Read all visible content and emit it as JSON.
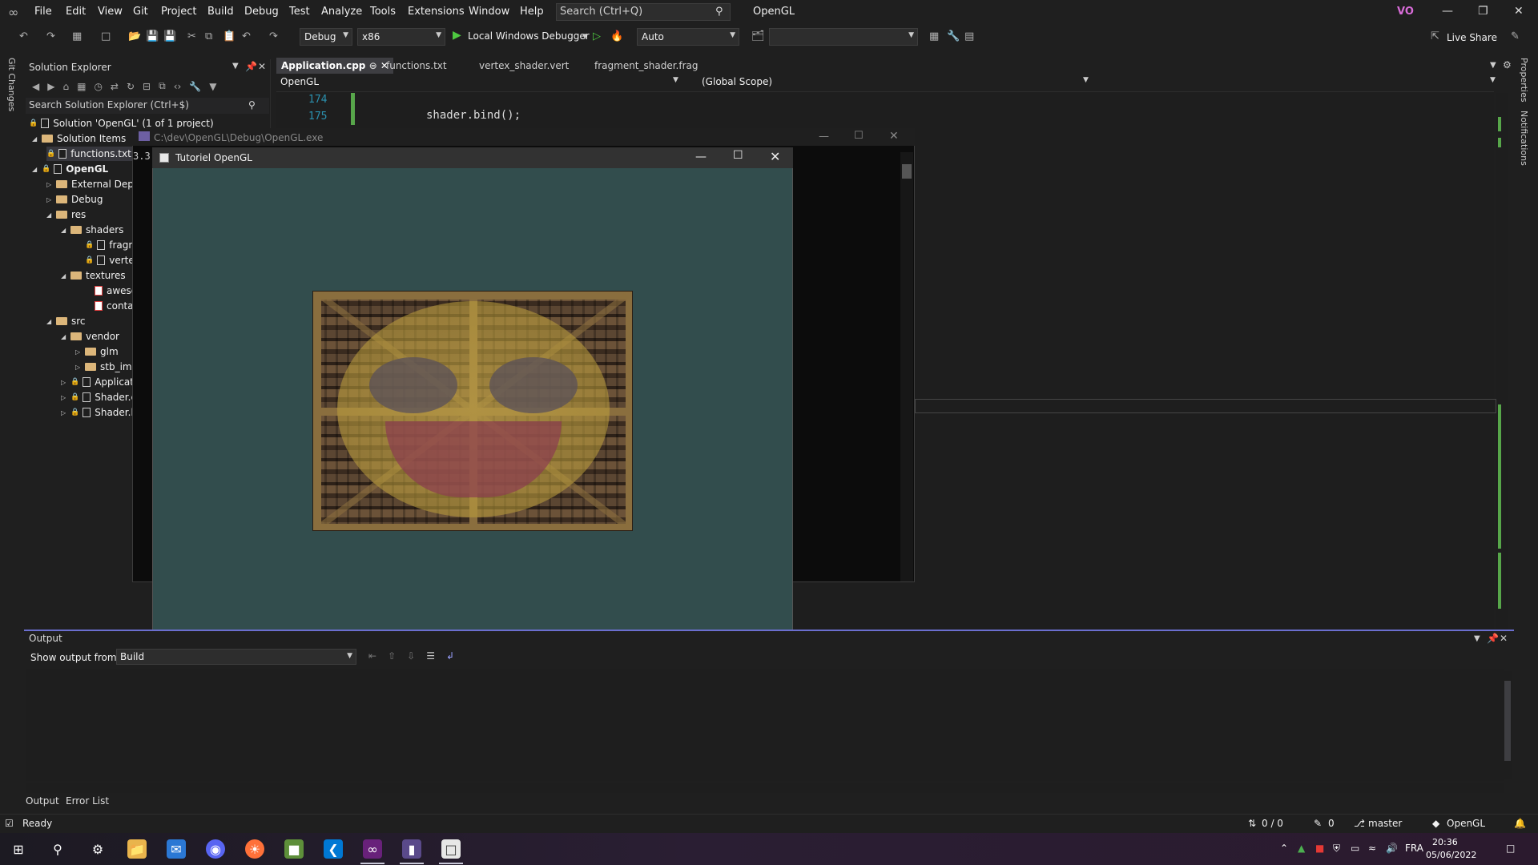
{
  "menubar": {
    "items": [
      "File",
      "Edit",
      "View",
      "Git",
      "Project",
      "Build",
      "Debug",
      "Test",
      "Analyze",
      "Tools",
      "Extensions",
      "Window",
      "Help"
    ],
    "search_placeholder": "Search (Ctrl+Q)",
    "solution_name": "OpenGL",
    "user_initials": "VO"
  },
  "toolbar": {
    "config": "Debug",
    "platform": "x86",
    "debugger": "Local Windows Debugger",
    "debug_mode": "Auto",
    "live_share": "Live Share"
  },
  "side": {
    "git_changes": "Git Changes",
    "properties": "Properties",
    "notifications": "Notifications"
  },
  "solution_explorer": {
    "title": "Solution Explorer",
    "search": "Search Solution Explorer (Ctrl+$)",
    "tree": [
      {
        "label": "Solution 'OpenGL' (1 of 1 project)"
      },
      {
        "label": "Solution Items"
      },
      {
        "label": "functions.txt"
      },
      {
        "label": "OpenGL"
      },
      {
        "label": "External Dependencies"
      },
      {
        "label": "Debug"
      },
      {
        "label": "res"
      },
      {
        "label": "shaders"
      },
      {
        "label": "fragment_shader.frag"
      },
      {
        "label": "vertex_shader.vert"
      },
      {
        "label": "textures"
      },
      {
        "label": "awesomeface.png"
      },
      {
        "label": "container.jpg"
      },
      {
        "label": "src"
      },
      {
        "label": "vendor"
      },
      {
        "label": "glm"
      },
      {
        "label": "stb_image"
      },
      {
        "label": "Application.cpp"
      },
      {
        "label": "Shader.cpp"
      },
      {
        "label": "Shader.h"
      }
    ]
  },
  "editor": {
    "tabs": [
      "Application.cpp",
      "functions.txt",
      "vertex_shader.vert",
      "fragment_shader.frag"
    ],
    "nav_project": "OpenGL",
    "nav_scope": "(Global Scope)",
    "lines": [
      {
        "no": "174",
        "code": ""
      },
      {
        "no": "175",
        "code": "shader.bind();"
      }
    ]
  },
  "console": {
    "title": "C:\\dev\\OpenGL\\Debug\\OpenGL.exe",
    "text": "3.3"
  },
  "glwindow": {
    "title": "Tutoriel OpenGL",
    "clear_color": "#324d4d"
  },
  "output": {
    "title": "Output",
    "show_from_label": "Show output from:",
    "source": "Build",
    "bottom_tabs": [
      "Output",
      "Error List"
    ]
  },
  "status": {
    "ready": "Ready",
    "lines": "0 / 0",
    "pencil": "0",
    "branch": "master",
    "project": "OpenGL"
  },
  "taskbar": {
    "lang": "FRA",
    "time": "20:36",
    "date": "05/06/2022"
  }
}
